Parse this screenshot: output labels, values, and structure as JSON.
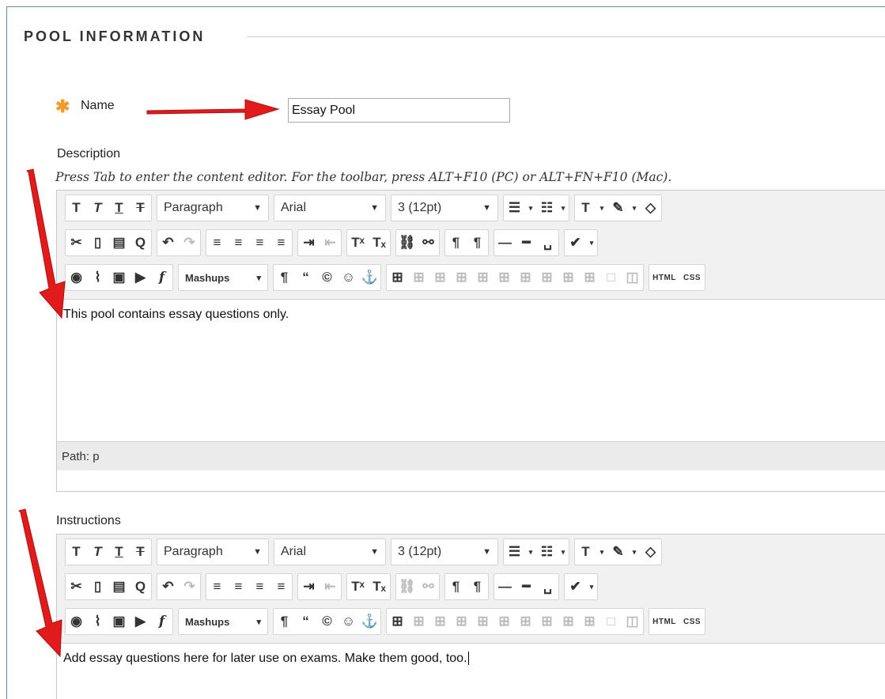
{
  "section": {
    "title": "POOL INFORMATION"
  },
  "name_field": {
    "label": "Name",
    "value": "Essay Pool",
    "required_marker": "✱"
  },
  "description": {
    "label": "Description",
    "hint": "Press Tab to enter the content editor. For the toolbar, press ALT+F10 (PC) or ALT+FN+F10 (Mac).",
    "content": "This pool contains essay questions only.",
    "path_label": "Path:",
    "path_value": "p"
  },
  "instructions": {
    "label": "Instructions",
    "content": "Add essay questions here for later use on exams. Make them good, too."
  },
  "toolbar": {
    "format_select": "Paragraph",
    "font_select": "Arial",
    "size_select": "3 (12pt)",
    "mashups_label": "Mashups",
    "html_label": "HTML",
    "css_label": "CSS"
  },
  "colors": {
    "accent": "#f39a2a",
    "arrow": "#e11b1b",
    "frame": "#5d8cae"
  }
}
